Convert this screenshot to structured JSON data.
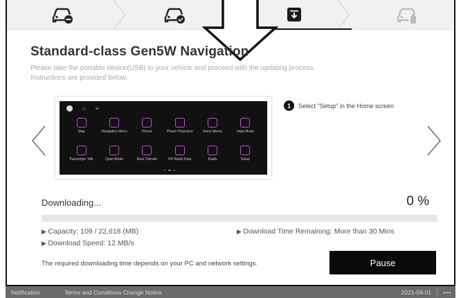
{
  "steps": [
    {
      "icon": "car-remove-icon",
      "state": "done"
    },
    {
      "icon": "car-check-icon",
      "state": "done"
    },
    {
      "icon": "download-box-icon",
      "state": "active"
    },
    {
      "icon": "car-usb-icon",
      "state": "pending"
    }
  ],
  "title": "Standard-class Gen5W Navigation",
  "subtitle": "Please take the portable device(USB) to your vehicle and proceed with the updating process. Instructions are provided below.",
  "carousel": {
    "hint_number": "1",
    "hint_text": "Select \"Setup\" in the Home screen",
    "apps": [
      "Map",
      "Navigation Menu",
      "Phone",
      "Phone Projection",
      "Voice Memo",
      "Valet Mode",
      "Passenger Talk",
      "Quiet Mode",
      "Rear Climate",
      "HD Radio Data",
      "Radio",
      "Setup"
    ]
  },
  "download": {
    "label": "Downloading...",
    "percent_text": "0 %",
    "progress": 0,
    "capacity": "Capacity: 109 / 22,618 (MB)",
    "time_remaining": "Download Time Remaining: More than 30 Mins",
    "speed": "Download Speed: 12 MB/s",
    "note": "The required downloading time depends on your PC and network settings.",
    "pause_label": "Pause"
  },
  "statusbar": {
    "notification": "Notification",
    "terms": "Terms and Conditions Change Notice",
    "date": "2021-04-01",
    "more": "•••"
  },
  "colors": {
    "accent": "#0a0a0a",
    "app_icon": "#c44bd6",
    "statusbar": "#6b6b6b"
  }
}
